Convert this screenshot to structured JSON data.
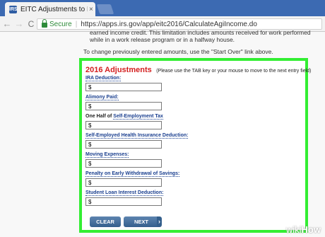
{
  "browser": {
    "tab_title": "EITC Adjustments to Inc",
    "tab_close": "×",
    "favicon": "IRS",
    "secure_label": "Secure",
    "separator": "|",
    "url": "https://apps.irs.gov/app/eitc2016/CalculateAgiIncome.do",
    "back_glyph": "←",
    "forward_glyph": "→",
    "reload_glyph": "C"
  },
  "page": {
    "intro_text": "earned income credit. This limitation includes amounts received for work performed while in a work release program or in a halfway house.",
    "start_over_note": "To change previously entered amounts, use the \"Start Over\" link above.",
    "adjustments": {
      "heading": "2016 Adjustments",
      "instruction": "(Please use the TAB key or your mouse to move to the next entry field)",
      "fields": [
        {
          "prefix": "",
          "link": "IRA Deduction:",
          "value": "$"
        },
        {
          "prefix": "",
          "link": "Alimony Paid:",
          "value": "$"
        },
        {
          "prefix": "One Half of ",
          "link": "Self-Employment Tax",
          "value": "$"
        },
        {
          "prefix": "",
          "link": "Self-Employed Health Insurance Deduction:",
          "value": "$"
        },
        {
          "prefix": "",
          "link": "Moving Expenses:",
          "value": "$"
        },
        {
          "prefix": "",
          "link": "Penalty on Early Withdrawal of Savings:",
          "value": "$"
        },
        {
          "prefix": "",
          "link": "Student Loan Interest Deduction:",
          "value": "$"
        }
      ],
      "clear_label": "CLEAR",
      "next_label": "NEXT",
      "next_chevron": "›"
    }
  },
  "watermark": {
    "part1": "wiki",
    "part2": "How"
  },
  "colors": {
    "heading": "#d31f1f",
    "highlight_border": "#33ee33",
    "chrome": "#3c6ab2",
    "button": "#345f8c"
  }
}
